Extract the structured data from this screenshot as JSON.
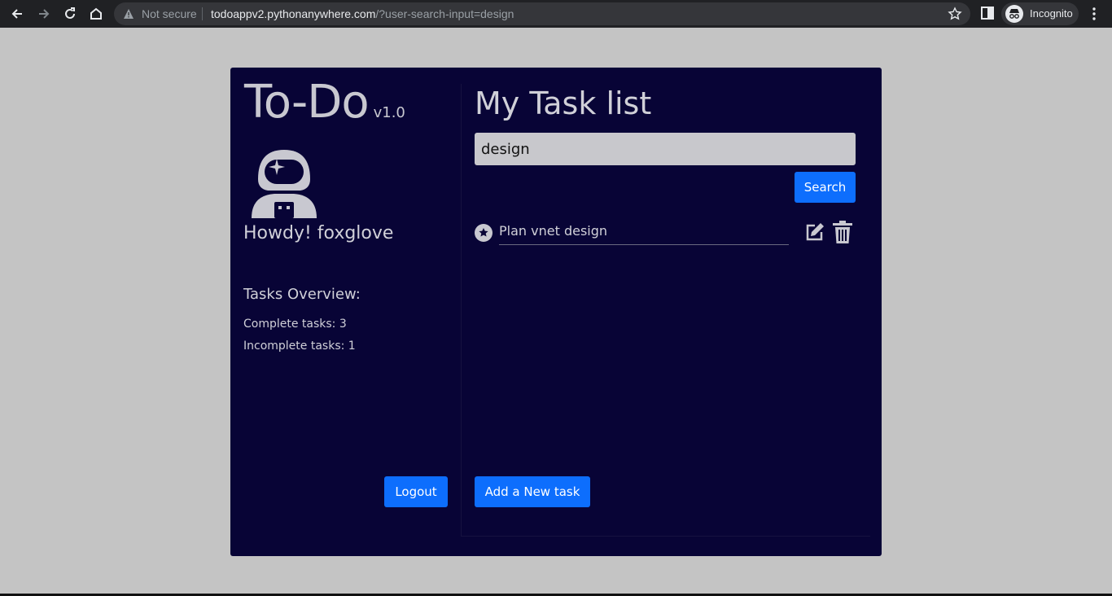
{
  "browser": {
    "security_label": "Not secure",
    "url_host": "todoappv2.pythonanywhere.com",
    "url_path": "/?user-search-input=design",
    "profile_label": "Incognito"
  },
  "app": {
    "logo_text": "To-Do",
    "version": "v1.0",
    "greeting": "Howdy! foxglove",
    "overview_title": "Tasks Overview:",
    "complete_tasks": "Complete tasks: 3",
    "incomplete_tasks": "Incomplete tasks: 1",
    "logout_label": "Logout"
  },
  "tasks": {
    "title": "My Task list",
    "search_value": "design",
    "search_button": "Search",
    "items": [
      {
        "label": "Plan vnet design",
        "icon": "star-circle-icon"
      }
    ],
    "add_button": "Add a New task"
  },
  "colors": {
    "card_bg": "#080436",
    "accent": "#0d6efd",
    "page_bg": "#c4c4c4",
    "text": "#d0d0d8"
  }
}
